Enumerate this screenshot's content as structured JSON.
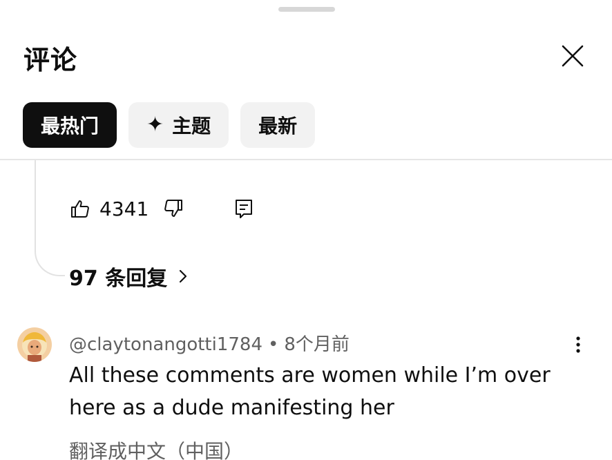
{
  "header": {
    "title": "评论",
    "close_icon": "close-icon"
  },
  "tabs": [
    {
      "label": "最热门",
      "active": true
    },
    {
      "label": "主题",
      "icon": "sparkle-icon",
      "active": false
    },
    {
      "label": "最新",
      "active": false
    }
  ],
  "previous_comment": {
    "like_count": "4341",
    "replies_label": "97 条回复"
  },
  "comment": {
    "author": "@claytonangotti1784",
    "separator": "•",
    "time": "8个月前",
    "text": "All these comments are women while I’m over here as a dude manifesting her",
    "translate_label": "翻译成中文（中国）"
  },
  "colors": {
    "active_tab_bg": "#0f0f0f",
    "tab_bg": "#f2f2f2",
    "secondary_text": "#606060"
  }
}
